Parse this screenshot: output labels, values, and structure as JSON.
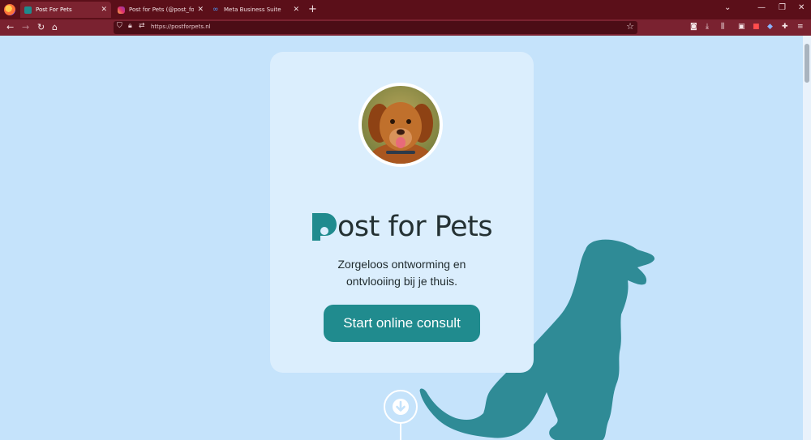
{
  "browser": {
    "tabs": [
      {
        "label": "Post For Pets",
        "active": true
      },
      {
        "label": "Post for Pets (@post_for_pets) •",
        "active": false
      },
      {
        "label": "Meta Business Suite",
        "active": false
      }
    ],
    "url": "https://postforpets.nl"
  },
  "hero": {
    "brand": "ost for Pets",
    "tagline_line1": "Zorgeloos ontworming en",
    "tagline_line2": "ontvlooiing bij je thuis.",
    "cta_label": "Start online consult"
  },
  "colors": {
    "accent": "#208b8e",
    "page_bg": "#c5e3fb",
    "card_bg": "#dbeefd",
    "chrome": "#5b0f19"
  },
  "icons": [
    "firefox-icon",
    "back-icon",
    "forward-icon",
    "reload-icon",
    "home-icon",
    "shield-icon",
    "lock-icon",
    "bookmark-star-icon",
    "arrow-down-icon"
  ]
}
